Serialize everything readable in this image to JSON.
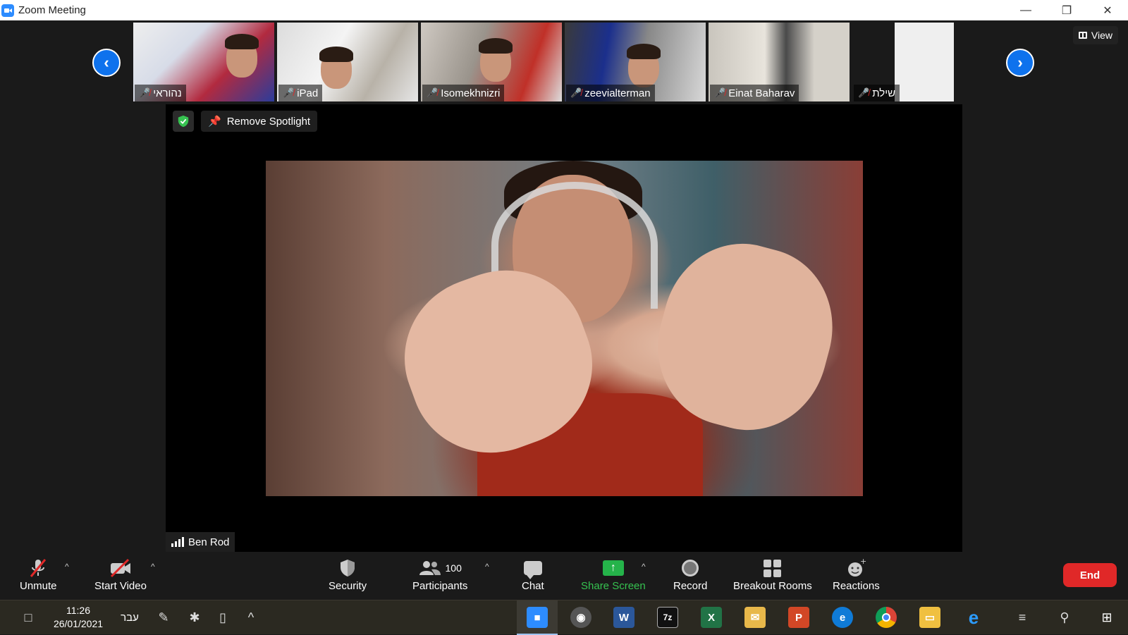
{
  "window": {
    "title": "Zoom Meeting",
    "controls": [
      "minimize",
      "restore",
      "close"
    ]
  },
  "gallery": {
    "participants": [
      {
        "name": "נהוראי",
        "muted": true
      },
      {
        "name": "iPad",
        "muted": true
      },
      {
        "name": "Isomekhnizri",
        "muted": true
      },
      {
        "name": "zeevialterman",
        "muted": true
      },
      {
        "name": "Einat Baharav",
        "muted": true
      },
      {
        "name": "שילת",
        "muted": true
      }
    ],
    "view_label": "View"
  },
  "spotlight": {
    "remove_label": "Remove Spotlight",
    "speaker_name": "Ben Rod"
  },
  "toolbar": {
    "unmute": "Unmute",
    "start_video": "Start Video",
    "security": "Security",
    "participants": "Participants",
    "participants_count": "100",
    "chat": "Chat",
    "share_screen": "Share Screen",
    "record": "Record",
    "breakout_rooms": "Breakout Rooms",
    "reactions": "Reactions",
    "end": "End"
  },
  "taskbar": {
    "time": "11:26",
    "date": "26/01/2021",
    "language": "עבר",
    "apps": [
      "zoom",
      "media",
      "word",
      "7zip",
      "excel",
      "outlook",
      "powerpoint",
      "edge",
      "chrome",
      "explorer",
      "ie"
    ]
  },
  "colors": {
    "accent_blue": "#0e72ed",
    "end_red": "#e02828",
    "share_green": "#25b34a",
    "mute_red": "#e02828"
  }
}
